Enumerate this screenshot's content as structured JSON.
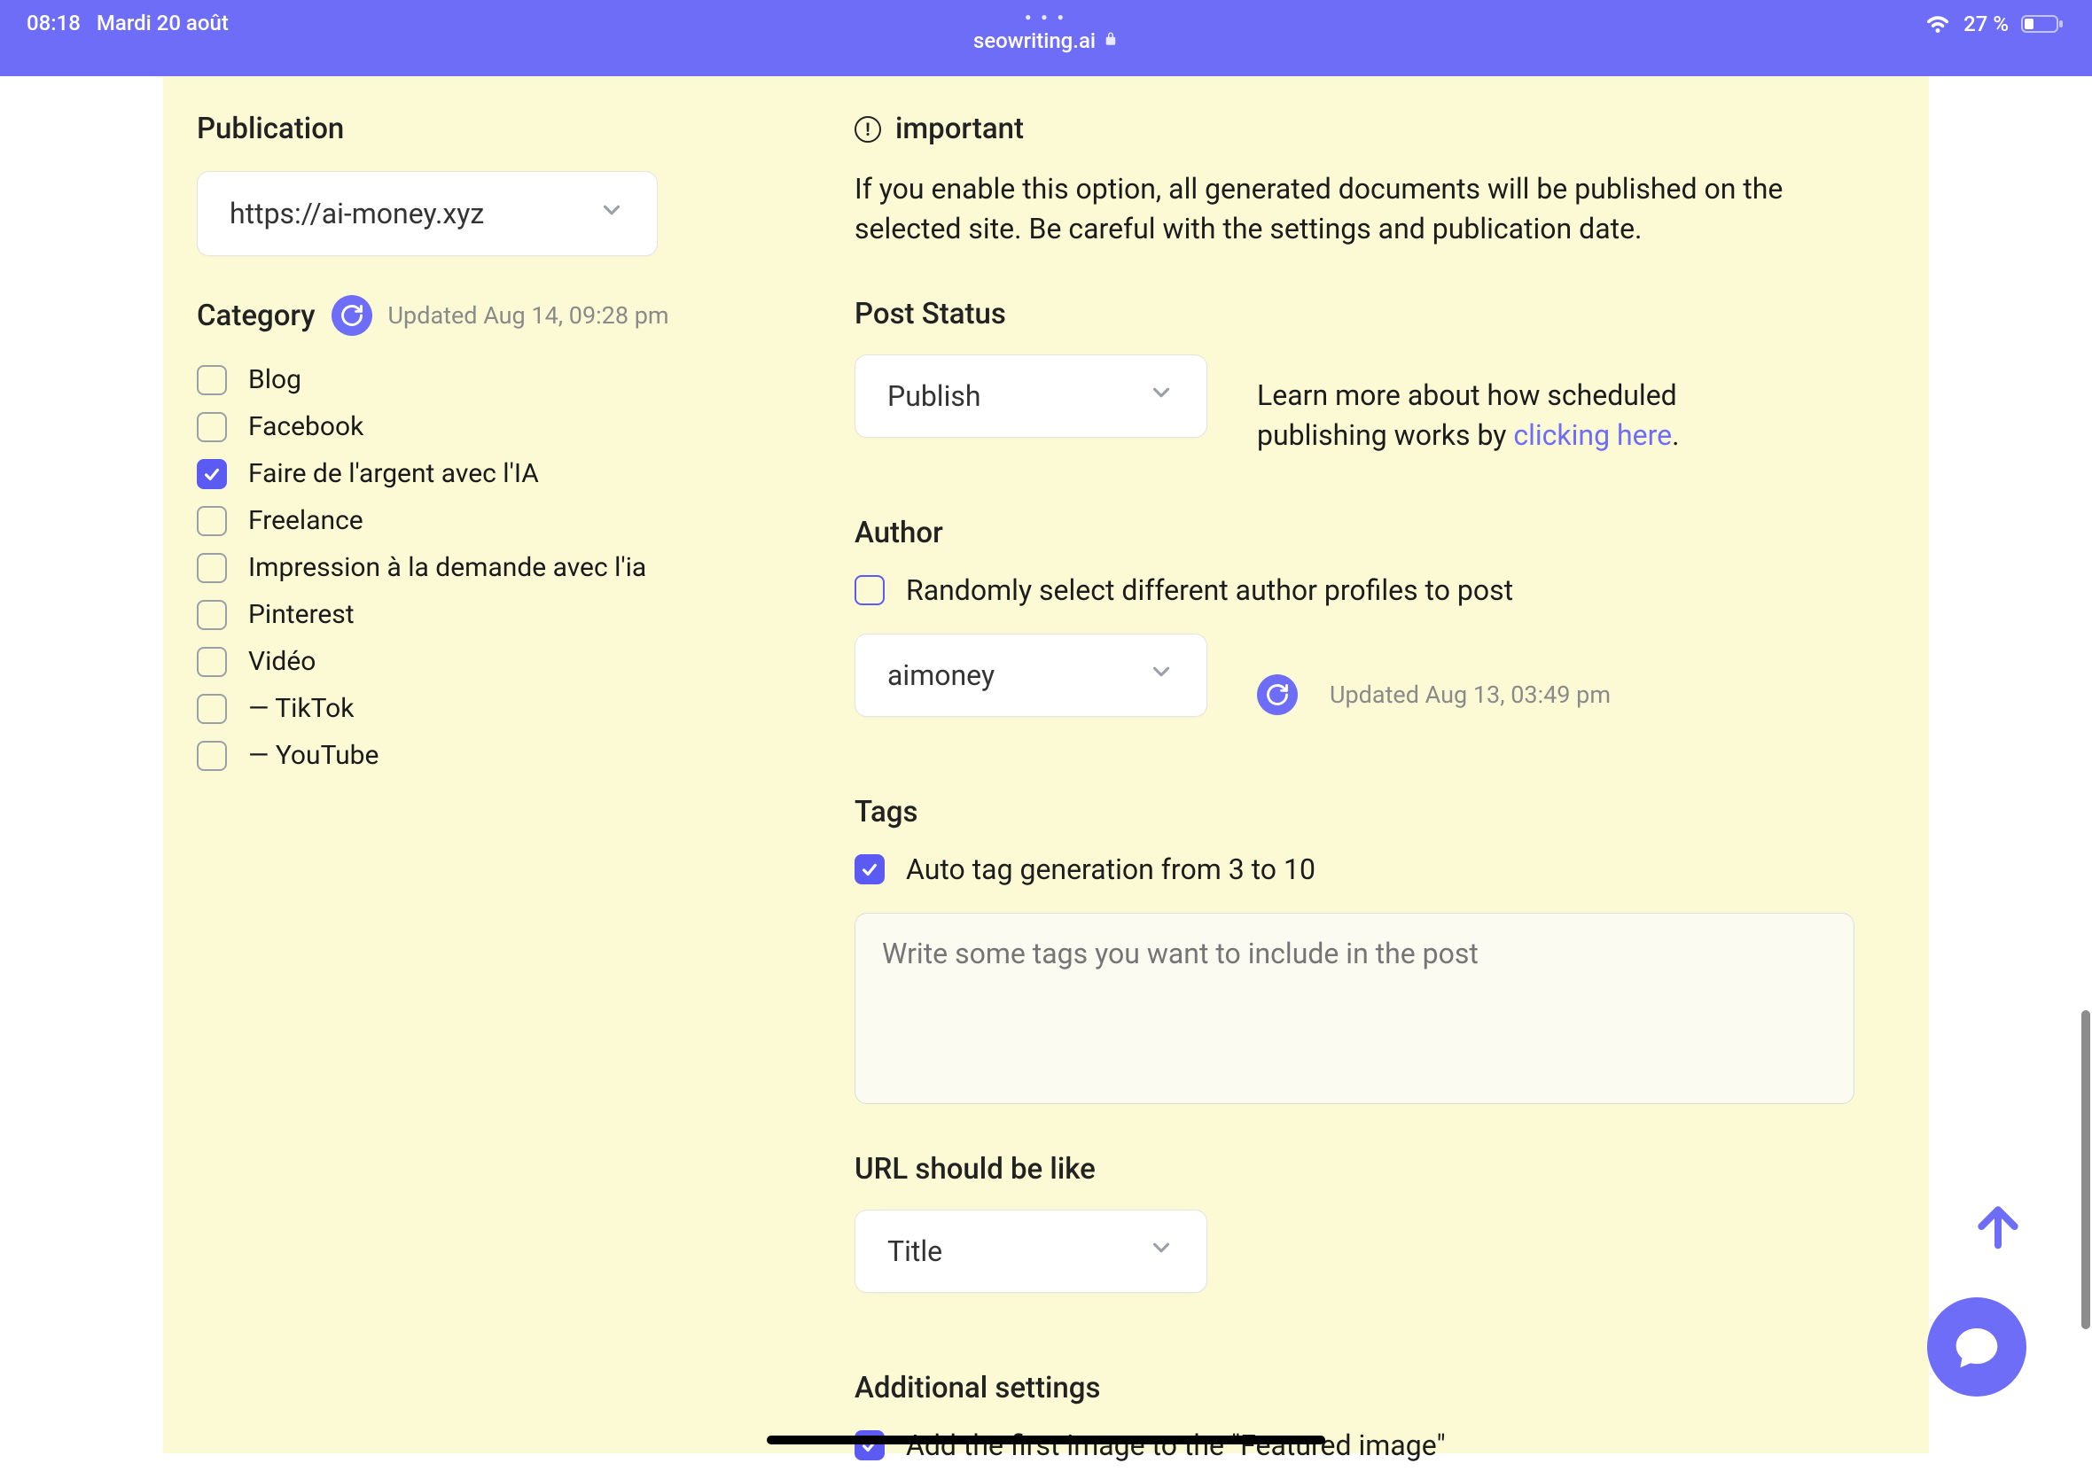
{
  "status": {
    "time": "08:18",
    "date": "Mardi 20 août",
    "url": "seowriting.ai",
    "battery": "27 %"
  },
  "left": {
    "publication_label": "Publication",
    "publication_value": "https://ai-money.xyz",
    "category_label": "Category",
    "category_updated": "Updated Aug 14, 09:28 pm",
    "categories": [
      {
        "label": "Blog",
        "checked": false
      },
      {
        "label": "Facebook",
        "checked": false
      },
      {
        "label": "Faire de l'argent avec l'IA",
        "checked": true
      },
      {
        "label": "Freelance",
        "checked": false
      },
      {
        "label": "Impression à la demande avec l'ia",
        "checked": false
      },
      {
        "label": "Pinterest",
        "checked": false
      },
      {
        "label": "Vidéo",
        "checked": false
      },
      {
        "label": "— TikTok",
        "checked": false
      },
      {
        "label": "— YouTube",
        "checked": false
      }
    ]
  },
  "right": {
    "important_label": "important",
    "important_text": "If you enable this option, all generated documents will be published on the selected site. Be careful with the settings and publication date.",
    "post_status_label": "Post Status",
    "post_status_value": "Publish",
    "post_status_help_pre": "Learn more about how scheduled publishing works by ",
    "post_status_help_link": "clicking here",
    "post_status_help_suf": ".",
    "author_label": "Author",
    "author_random_label": "Randomly select different author profiles to post",
    "author_value": "aimoney",
    "author_updated": "Updated Aug 13, 03:49 pm",
    "tags_label": "Tags",
    "tags_auto_label": "Auto tag generation from 3 to 10",
    "tags_placeholder": "Write some tags you want to include in the post",
    "url_label": "URL should be like",
    "url_value": "Title",
    "addl_label": "Additional settings",
    "addl_featured_label": "Add the first image to the \"Featured image\""
  }
}
